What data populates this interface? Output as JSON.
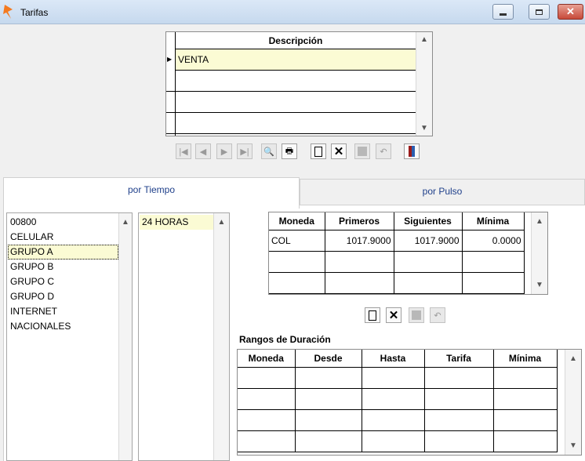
{
  "window": {
    "title": "Tarifas"
  },
  "top_grid": {
    "header": "Descripción",
    "rows": [
      "VENTA",
      "",
      "",
      ""
    ]
  },
  "nav_toolbar": {
    "buttons": [
      "first-icon",
      "prev-icon",
      "next-icon",
      "last-icon",
      "search-icon",
      "print-icon",
      "new-icon",
      "delete-icon",
      "save-icon",
      "undo-icon",
      "exit-icon"
    ]
  },
  "tabs": {
    "tiempo": "por Tiempo",
    "pulso": "por Pulso"
  },
  "groups": [
    "00800",
    "CELULAR",
    "GRUPO A",
    "GRUPO B",
    "GRUPO C",
    "GRUPO D",
    "INTERNET",
    "NACIONALES"
  ],
  "schedules": [
    "24 HORAS"
  ],
  "rates_grid": {
    "headers": [
      "Moneda",
      "Primeros",
      "Siguientes",
      "Mínima"
    ],
    "rows": [
      [
        "COL",
        "1017.9000",
        "1017.9000",
        "0.0000"
      ],
      [
        "",
        "",
        "",
        ""
      ],
      [
        "",
        "",
        "",
        ""
      ]
    ]
  },
  "ranges": {
    "title": "Rangos de Duración",
    "headers": [
      "Moneda",
      "Desde",
      "Hasta",
      "Tarifa",
      "Mínima"
    ],
    "rows": [
      [
        "",
        "",
        "",
        "",
        ""
      ],
      [
        "",
        "",
        "",
        "",
        ""
      ],
      [
        "",
        "",
        "",
        "",
        ""
      ],
      [
        "",
        "",
        "",
        "",
        ""
      ]
    ]
  },
  "colors": {
    "selected_row": "#fbfbd4",
    "title_bar": "#c6d9ee"
  }
}
